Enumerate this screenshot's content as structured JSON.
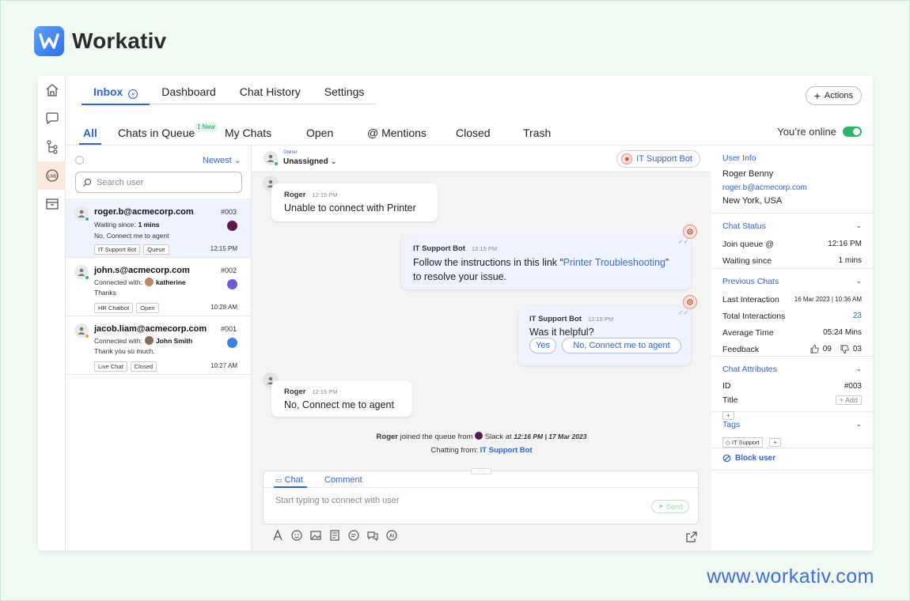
{
  "brand": {
    "name": "Workativ",
    "url": "www.workativ.com"
  },
  "topnav": {
    "tabs": [
      {
        "label": "Inbox",
        "active": true
      },
      {
        "label": "Dashboard"
      },
      {
        "label": "Chat History"
      },
      {
        "label": "Settings"
      }
    ],
    "actions_label": "Actions"
  },
  "subnav": {
    "tabs": [
      "All",
      "Chats in Queue",
      "My Chats",
      "Open",
      "@ Mentions",
      "Closed",
      "Trash"
    ],
    "new_badge": "1 New",
    "online_label": "You’re online"
  },
  "list": {
    "sort_label": "Newest",
    "search_placeholder": "Search user",
    "conversations": [
      {
        "email": "roger.b@acmecorp.com",
        "id": "#003",
        "line1_label": "Waiting since:",
        "line1_value": "1 mins",
        "line2": "No, Connect me to agent",
        "tags": [
          "IT Support Bot",
          "Queue"
        ],
        "time": "12:15 PM",
        "status_color": "#2bb36a",
        "channel_color": "#5b1a4e"
      },
      {
        "email": "john.s@acmecorp.com",
        "id": "#002",
        "line1_label": "Connected with:",
        "line1_value": "katherine",
        "line2": "Thanks",
        "tags": [
          "HR Chatbot",
          "Open"
        ],
        "time": "10:28 AM",
        "status_color": "#2bb36a",
        "channel_color": "#6b5bd6"
      },
      {
        "email": "jacob.liam@acmecorp.com",
        "id": "#001",
        "line1_label": "Connected with:",
        "line1_value": "John Smith",
        "line2": "Thank you so much.",
        "tags": [
          "Live Chat",
          "Closed"
        ],
        "time": "10:27 AM",
        "status_color": "#f39c3d",
        "channel_color": "#3b82e6"
      }
    ]
  },
  "chat": {
    "owner_label": "Owner",
    "owner_value": "Unassigned",
    "bot_name": "IT Support Bot",
    "messages": {
      "m1": {
        "sender": "Roger",
        "time": "12:15 PM",
        "text": "Unable to connect with Printer"
      },
      "m2": {
        "sender": "IT Support Bot",
        "time": "12:15 PM",
        "text_before": "Follow the instructions in this link “",
        "link": "Printer Troubleshooting",
        "text_after": "”",
        "text_line2": "to resolve your issue."
      },
      "m3": {
        "sender": "IT Support Bot",
        "time": "12:15 PM",
        "text": "Was it helpful?",
        "options": [
          "Yes",
          "No, Connect me to agent"
        ]
      },
      "m4": {
        "sender": "Roger",
        "time": "12:15 PM",
        "text": "No, Connect me to agent"
      }
    },
    "system": {
      "name": "Roger",
      "text1": "joined the queue from",
      "channel": "Slack",
      "at": "at",
      "datetime": "12:16 PM | 17 Mar 2023",
      "chatting_label": "Chatting from:",
      "chatting_value": "IT Support Bot"
    },
    "composer": {
      "tab_chat": "Chat",
      "tab_comment": "Comment",
      "placeholder": "Start typing to connect with user",
      "send_label": "Send"
    }
  },
  "info": {
    "user_info": {
      "title": "User Info",
      "name": "Roger Benny",
      "email": "roger.b@acmecorp.com",
      "location": "New York, USA"
    },
    "chat_status": {
      "title": "Chat Status",
      "join_label": "Join queue @",
      "join_value": "12:16 PM",
      "wait_label": "Waiting since",
      "wait_value": "1 mins"
    },
    "previous": {
      "title": "Previous Chats",
      "last_label": "Last Interaction",
      "last_value": "16 Mar 2023 | 10:36 AM",
      "total_label": "Total Interactions",
      "total_value": "23",
      "avg_label": "Average Time",
      "avg_value": "05:24 Mins",
      "feedback_label": "Feedback",
      "likes": "09",
      "dislikes": "03"
    },
    "attributes": {
      "title": "Chat Attributes",
      "id_label": "ID",
      "id_value": "#003",
      "title_label": "Title",
      "add_label": "+ Add",
      "plus": "+"
    },
    "tags": {
      "title": "Tags",
      "items": [
        "IT Support"
      ],
      "plus": "+"
    },
    "block_label": "Block user"
  },
  "colors": {
    "accent": "#2e64d6",
    "online": "#2bb36a",
    "highlight": "#fde8de"
  }
}
